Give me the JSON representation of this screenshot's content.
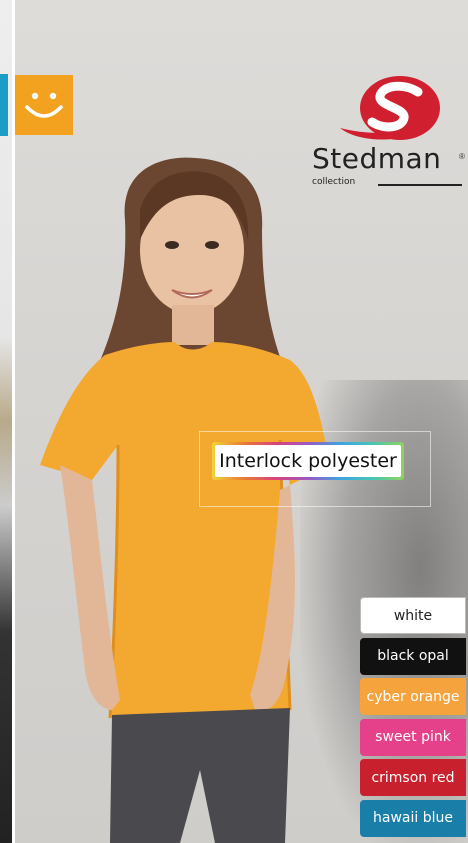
{
  "brand": {
    "name": "Stedman",
    "registered": "®",
    "sub": "collection"
  },
  "badge": {
    "icon": "smiley-icon"
  },
  "product": {
    "label": "Interlock polyester"
  },
  "colors": {
    "accent_orange": "#f3a21f",
    "tshirt": "#f3a830",
    "logo_red": "#d0202f"
  },
  "swatches": [
    {
      "label": "white",
      "bg": "#ffffff",
      "fg": "#222222"
    },
    {
      "label": "black opal",
      "bg": "#111111",
      "fg": "#ffffff"
    },
    {
      "label": "cyber orange",
      "bg": "#f5a33c",
      "fg": "#ffffff"
    },
    {
      "label": "sweet pink",
      "bg": "#e5408a",
      "fg": "#ffffff"
    },
    {
      "label": "crimson red",
      "bg": "#c8202d",
      "fg": "#ffffff"
    },
    {
      "label": "hawaii blue",
      "bg": "#1a7fa8",
      "fg": "#ffffff"
    }
  ]
}
